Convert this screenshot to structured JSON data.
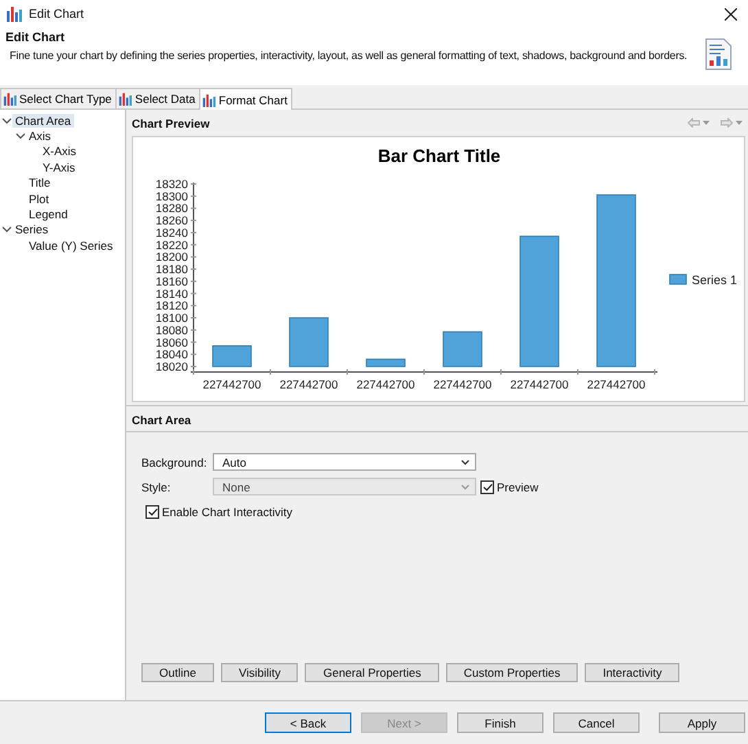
{
  "window": {
    "title": "Edit Chart"
  },
  "header": {
    "title": "Edit Chart",
    "description": "Fine tune your chart by defining the series properties, interactivity, layout, as well as general formatting of text, shadows, background and borders."
  },
  "tabs": [
    {
      "label": "Select Chart Type",
      "selected": false
    },
    {
      "label": "Select Data",
      "selected": false
    },
    {
      "label": "Format Chart",
      "selected": true
    }
  ],
  "tree": [
    {
      "label": "Chart Area",
      "selected": true,
      "expanded": true,
      "children": [
        {
          "label": "Axis",
          "selected": false,
          "expanded": true,
          "children": [
            {
              "label": "X-Axis",
              "selected": false
            },
            {
              "label": "Y-Axis",
              "selected": false
            }
          ]
        },
        {
          "label": "Title",
          "selected": false
        },
        {
          "label": "Plot",
          "selected": false
        },
        {
          "label": "Legend",
          "selected": false
        }
      ]
    },
    {
      "label": "Series",
      "selected": false,
      "expanded": true,
      "children": [
        {
          "label": "Value (Y) Series",
          "selected": false
        }
      ]
    }
  ],
  "preview": {
    "title": "Chart Preview",
    "chart_data": {
      "type": "bar",
      "title": "Bar Chart Title",
      "categories": [
        "227442700",
        "227442700",
        "227442700",
        "227442700",
        "227442700",
        "227442700"
      ],
      "series": [
        {
          "name": "Series 1",
          "color": "#4fa3d9",
          "values": [
            18054,
            18100,
            18032,
            18077,
            18234,
            18302
          ]
        }
      ],
      "ylim": [
        18020,
        18320
      ],
      "yticks": [
        18020,
        18040,
        18060,
        18080,
        18100,
        18120,
        18140,
        18160,
        18180,
        18200,
        18220,
        18240,
        18260,
        18280,
        18300,
        18320
      ]
    }
  },
  "chart_area": {
    "title": "Chart Area",
    "background": {
      "label": "Background:",
      "value": "Auto",
      "disabled": false
    },
    "style": {
      "label": "Style:",
      "value": "None",
      "disabled": true
    },
    "preview_checkbox": {
      "label": "Preview",
      "checked": true
    },
    "interactivity_checkbox": {
      "label": "Enable Chart Interactivity",
      "checked": true
    },
    "buttons": [
      "Outline",
      "Visibility",
      "General Properties",
      "Custom Properties",
      "Interactivity"
    ]
  },
  "footer_buttons": [
    {
      "label": "< Back",
      "disabled": false,
      "default": true
    },
    {
      "label": "Next >",
      "disabled": true,
      "default": false
    },
    {
      "label": "Finish",
      "disabled": false,
      "default": false
    },
    {
      "label": "Cancel",
      "disabled": false,
      "default": false
    },
    {
      "label": "Apply",
      "disabled": false,
      "default": false
    }
  ]
}
